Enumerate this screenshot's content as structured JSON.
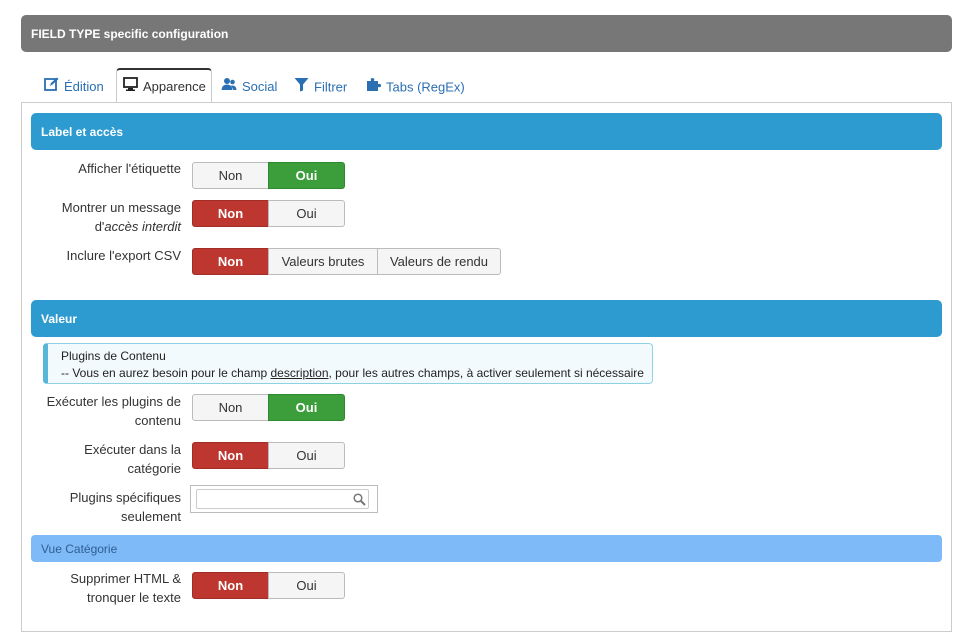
{
  "header": {
    "title": "FIELD TYPE specific configuration"
  },
  "tabs": [
    {
      "label": "Édition",
      "icon": "edit-icon"
    },
    {
      "label": "Apparence",
      "icon": "monitor-icon",
      "active": true
    },
    {
      "label": "Social",
      "icon": "users-icon"
    },
    {
      "label": "Filtrer",
      "icon": "filter-icon"
    },
    {
      "label": "Tabs (RegEx)",
      "icon": "puzzle-icon"
    }
  ],
  "sections": {
    "label_access": {
      "title": "Label et accès",
      "show_label": {
        "label": "Afficher l'étiquette",
        "options": [
          "Non",
          "Oui"
        ],
        "selected": "Oui"
      },
      "denied_msg": {
        "label_line1": "Montrer un message",
        "label_line2_prefix": "d'",
        "label_line2_italic": "accès interdit",
        "options": [
          "Non",
          "Oui"
        ],
        "selected": "Non"
      },
      "csv_export": {
        "label": "Inclure l'export CSV",
        "options": [
          "Non",
          "Valeurs brutes",
          "Valeurs de rendu"
        ],
        "selected": "Non"
      }
    },
    "value": {
      "title": "Valeur",
      "info": {
        "title": "Plugins de Contenu",
        "text_prefix": "-- Vous en aurez besoin pour le champ ",
        "text_link": "description",
        "text_suffix": ", pour les autres champs, à activer seulement si nécessaire"
      },
      "run_plugins": {
        "label_line1": "Exécuter les plugins de",
        "label_line2": "contenu",
        "options": [
          "Non",
          "Oui"
        ],
        "selected": "Oui"
      },
      "run_in_category": {
        "label_line1": "Exécuter dans la",
        "label_line2": "catégorie",
        "options": [
          "Non",
          "Oui"
        ],
        "selected": "Non"
      },
      "specific_plugins": {
        "label_line1": "Plugins spécifiques",
        "label_line2": "seulement",
        "value": "",
        "placeholder": ""
      }
    },
    "category_view": {
      "title": "Vue Catégorie",
      "strip_html": {
        "label_line1": "Supprimer HTML &",
        "label_line2": "tronquer le texte",
        "options": [
          "Non",
          "Oui"
        ],
        "selected": "Non"
      }
    }
  },
  "colors": {
    "header_bg": "#777777",
    "section_bg": "#2e9bd0",
    "subsection_bg": "#7ebaf7",
    "no_active": "#bd362f",
    "yes_active": "#3c9e3b",
    "tab_link": "#2a6fb2"
  }
}
